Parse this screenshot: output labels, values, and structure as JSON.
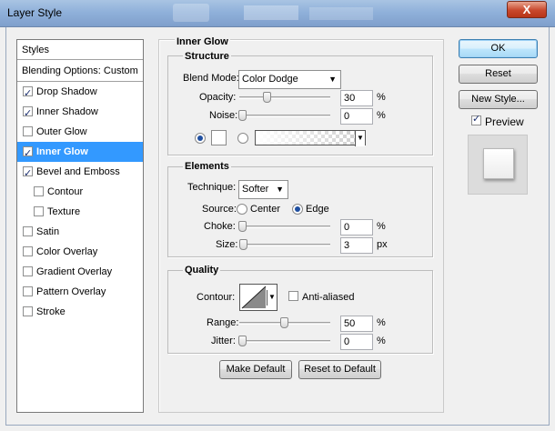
{
  "window": {
    "title": "Layer Style",
    "close_glyph": "X"
  },
  "sidebar": {
    "header": "Styles",
    "blending": "Blending Options: Custom",
    "items": [
      {
        "label": "Drop Shadow",
        "checked": true
      },
      {
        "label": "Inner Shadow",
        "checked": true
      },
      {
        "label": "Outer Glow",
        "checked": false
      },
      {
        "label": "Inner Glow",
        "checked": true,
        "selected": true
      },
      {
        "label": "Bevel and Emboss",
        "checked": true
      },
      {
        "label": "Contour",
        "checked": false,
        "indent": true
      },
      {
        "label": "Texture",
        "checked": false,
        "indent": true
      },
      {
        "label": "Satin",
        "checked": false
      },
      {
        "label": "Color Overlay",
        "checked": false
      },
      {
        "label": "Gradient Overlay",
        "checked": false
      },
      {
        "label": "Pattern Overlay",
        "checked": false
      },
      {
        "label": "Stroke",
        "checked": false
      }
    ]
  },
  "panel": {
    "title": "Inner Glow",
    "structure": {
      "heading": "Structure",
      "blend_mode_label": "Blend Mode:",
      "blend_mode_value": "Color Dodge",
      "opacity_label": "Opacity:",
      "opacity_value": "30",
      "opacity_level": 0.3,
      "noise_label": "Noise:",
      "noise_value": "0",
      "noise_level": 0.0,
      "percent": "%",
      "color_mode": "solid"
    },
    "elements": {
      "heading": "Elements",
      "technique_label": "Technique:",
      "technique_value": "Softer",
      "source_label": "Source:",
      "source_center": "Center",
      "source_edge": "Edge",
      "source_selected": "Edge",
      "choke_label": "Choke:",
      "choke_value": "0",
      "choke_level": 0.0,
      "size_label": "Size:",
      "size_value": "3",
      "size_level": 0.012,
      "percent": "%",
      "px": "px"
    },
    "quality": {
      "heading": "Quality",
      "contour_label": "Contour:",
      "anti_aliased_label": "Anti-aliased",
      "anti_aliased": false,
      "range_label": "Range:",
      "range_value": "50",
      "range_level": 0.5,
      "jitter_label": "Jitter:",
      "jitter_value": "0",
      "jitter_level": 0.0,
      "percent": "%"
    },
    "make_default": "Make Default",
    "reset_default": "Reset to Default"
  },
  "buttons": {
    "ok": "OK",
    "reset": "Reset",
    "new_style": "New Style...",
    "preview_label": "Preview",
    "preview_checked": true
  },
  "colors": {
    "selection": "#3399ff",
    "glow_color": "#ffffff"
  }
}
